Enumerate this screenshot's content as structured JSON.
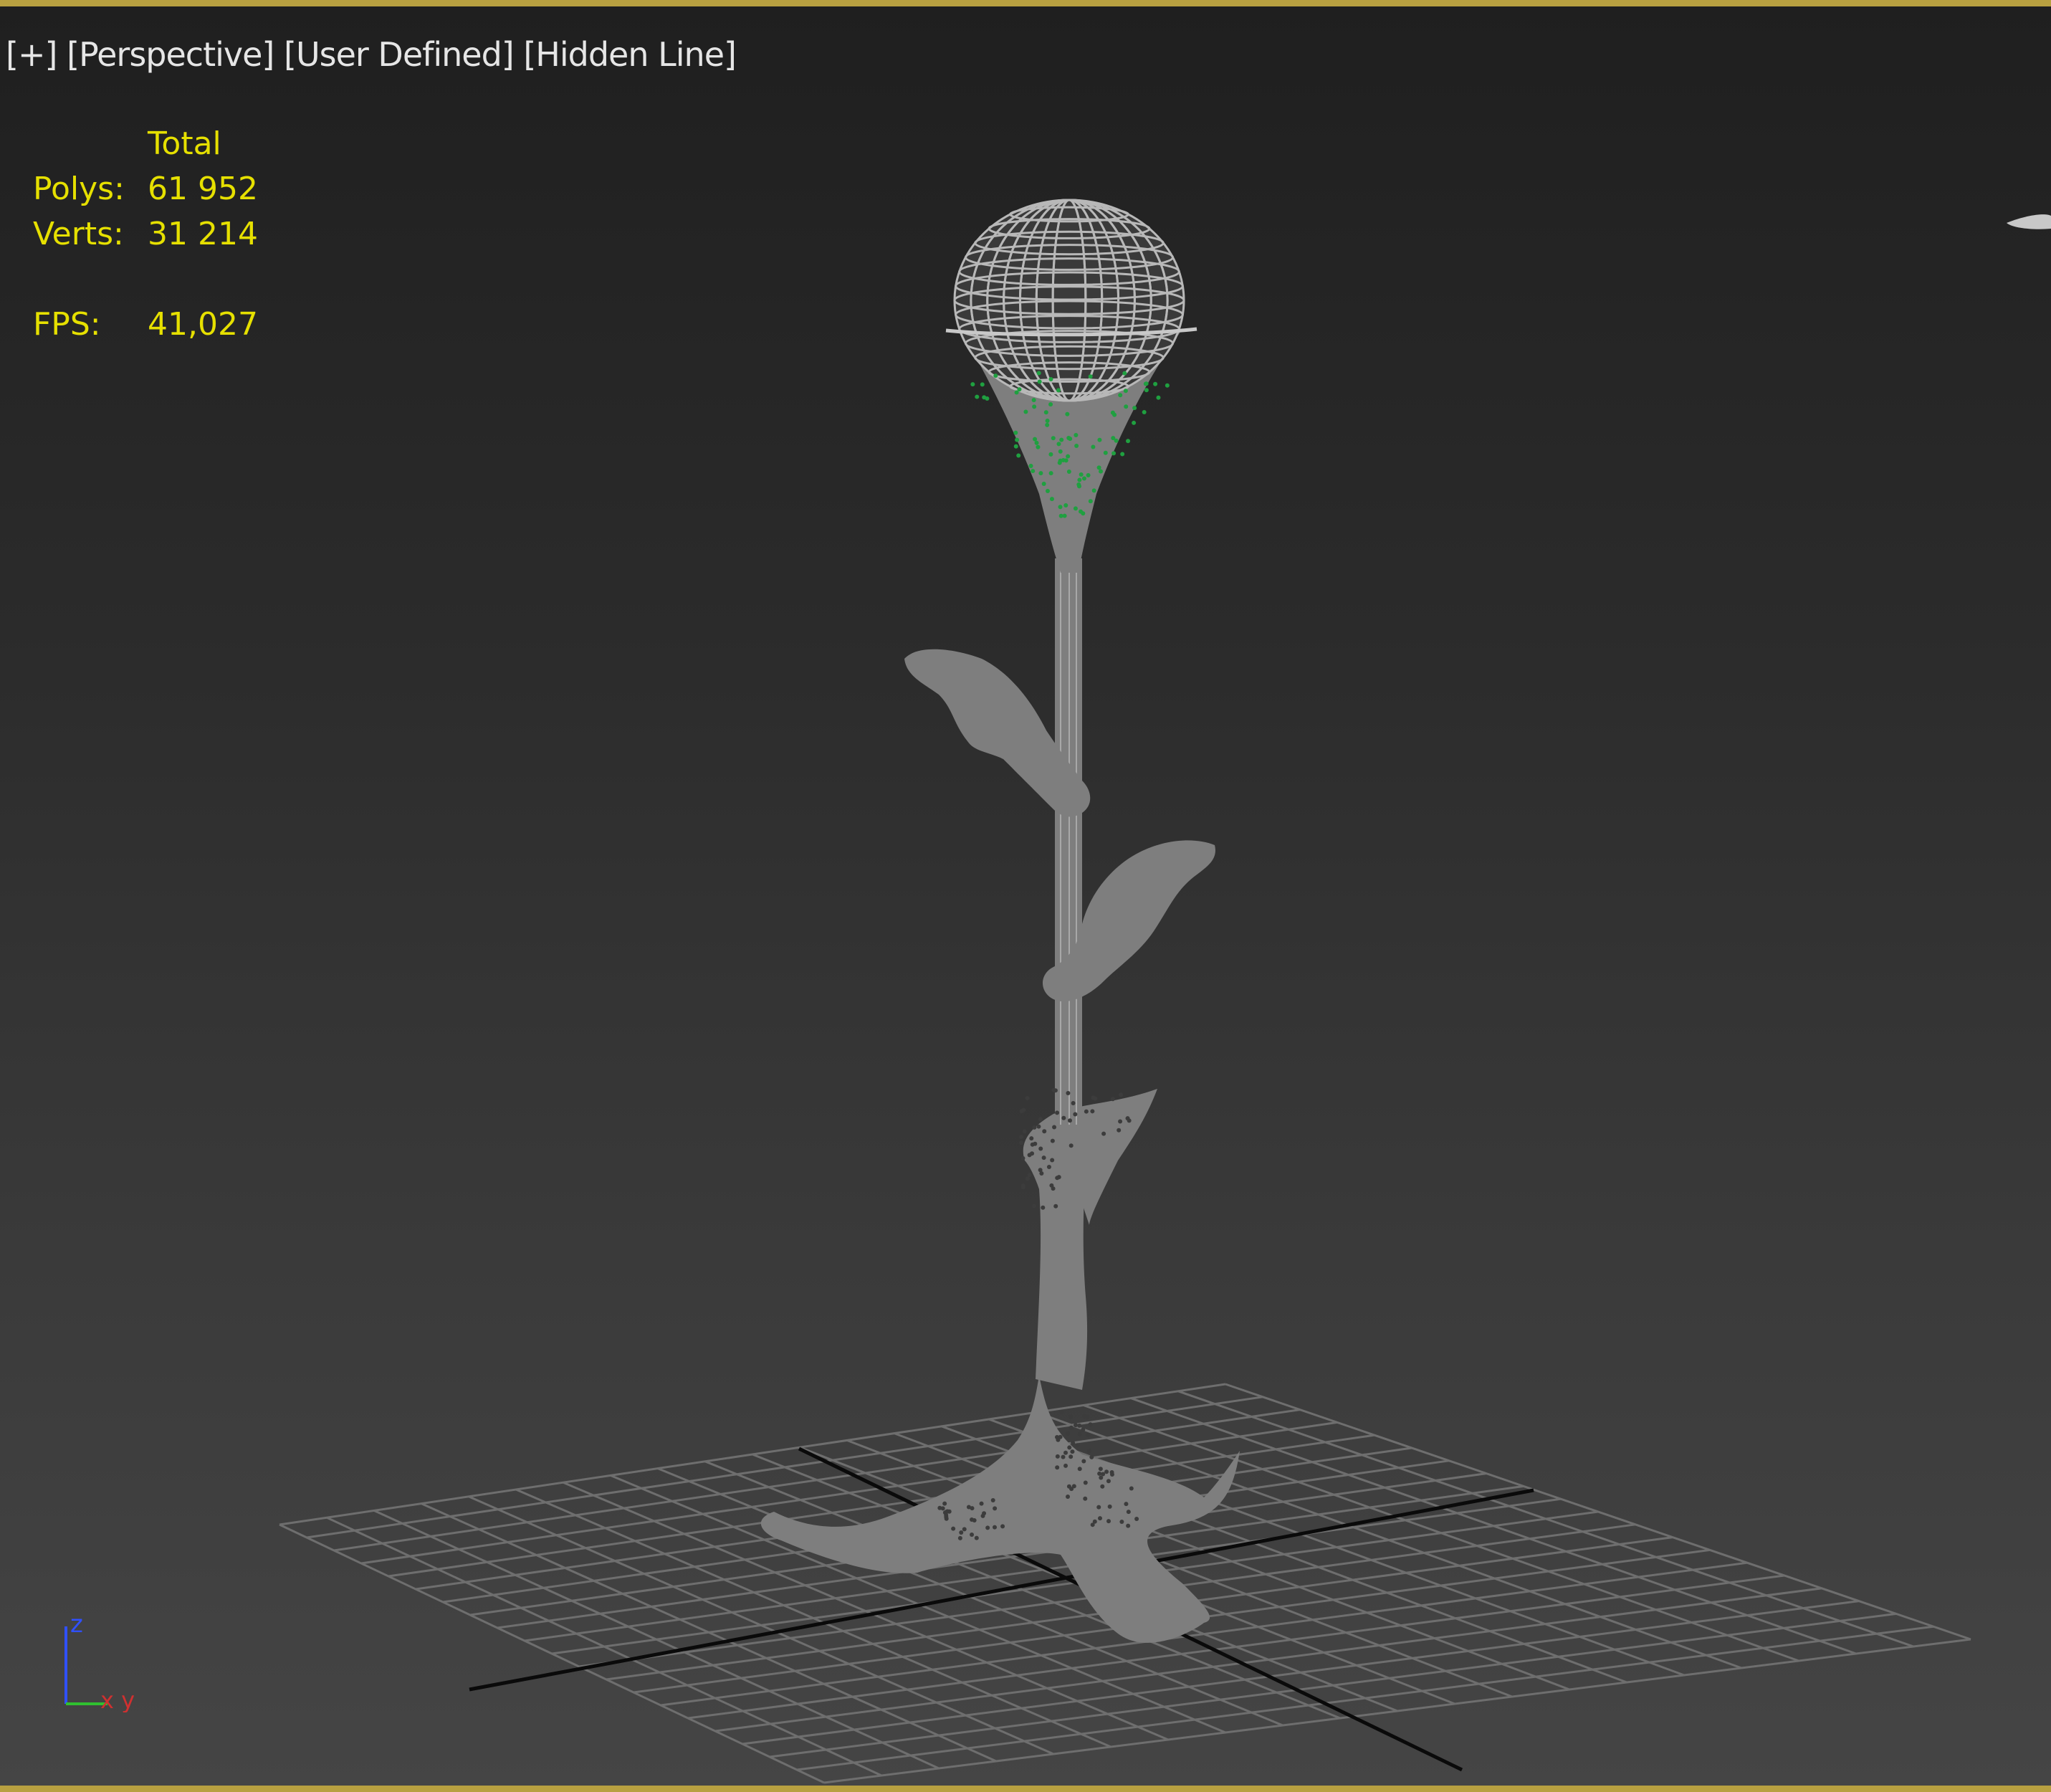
{
  "viewport": {
    "labels": [
      "[+]",
      "[Perspective]",
      "[User Defined]",
      "[Hidden Line]"
    ]
  },
  "stats": {
    "header": "Total",
    "polys_label": "Polys:",
    "polys_value": "61 952",
    "verts_label": "Verts:",
    "verts_value": "31 214",
    "fps_label": "FPS:",
    "fps_value": "41,027"
  },
  "gizmo": {
    "z_label": "z",
    "xy_label": "x y"
  },
  "colors": {
    "frame_border": "#b8a040",
    "stats_text": "#e6e000",
    "mesh_fill": "#7e7e7e",
    "mesh_wire": "#c8c8c8",
    "grid_line": "#6e6e6e",
    "grid_axis": "#0a0a0a",
    "vertex_dots": "#1fa040",
    "axis_z": "#3050ff",
    "axis_y": "#30c030"
  }
}
